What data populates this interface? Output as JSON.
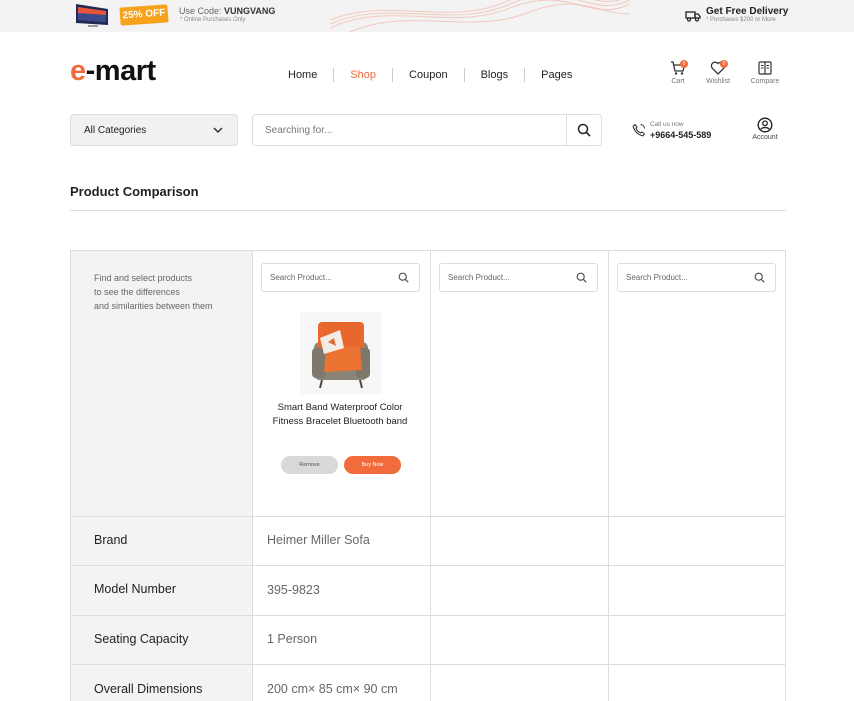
{
  "promo": {
    "badge": "25% OFF",
    "code_prefix": "Use Code:",
    "code": "VUNGVANG",
    "note": "* Online Purchases Only",
    "delivery_title": "Get Free Delivery",
    "delivery_note": "* Purchases $200 or More"
  },
  "brand": {
    "logo_first": "e",
    "logo_rest": "-mart",
    "accent": "#f16b3d"
  },
  "nav": [
    "Home",
    "Shop",
    "Coupon",
    "Blogs",
    "Pages"
  ],
  "nav_active": "Shop",
  "header_icons": {
    "cart": {
      "label": "Cart",
      "count": "0"
    },
    "wishlist": {
      "label": "Wishlist",
      "count": "0"
    },
    "compare": {
      "label": "Compare"
    }
  },
  "search": {
    "category": "All Categories",
    "placeholder": "Searching for..."
  },
  "call": {
    "label": "Call us now",
    "number": "+9664-545-589"
  },
  "account": {
    "label": "Account"
  },
  "page_title": "Product Comparison",
  "compare": {
    "intro": [
      "Find and select products",
      "to see the differences",
      "and similarities between them"
    ],
    "search_placeholder": "Search Product...",
    "product": {
      "name_lines": [
        "Smart Band Waterproof Color",
        "Fitness Bracelet Bluetooth band"
      ],
      "remove": "Remove",
      "buy": "Buy Now"
    },
    "rows": [
      {
        "label": "Brand",
        "value": "Heimer Miller Sofa"
      },
      {
        "label": "Model Number",
        "value": "395-9823"
      },
      {
        "label": "Seating Capacity",
        "value": "1 Person"
      },
      {
        "label": "Overall Dimensions",
        "value": "200 cm× 85 cm× 90 cm"
      }
    ]
  }
}
